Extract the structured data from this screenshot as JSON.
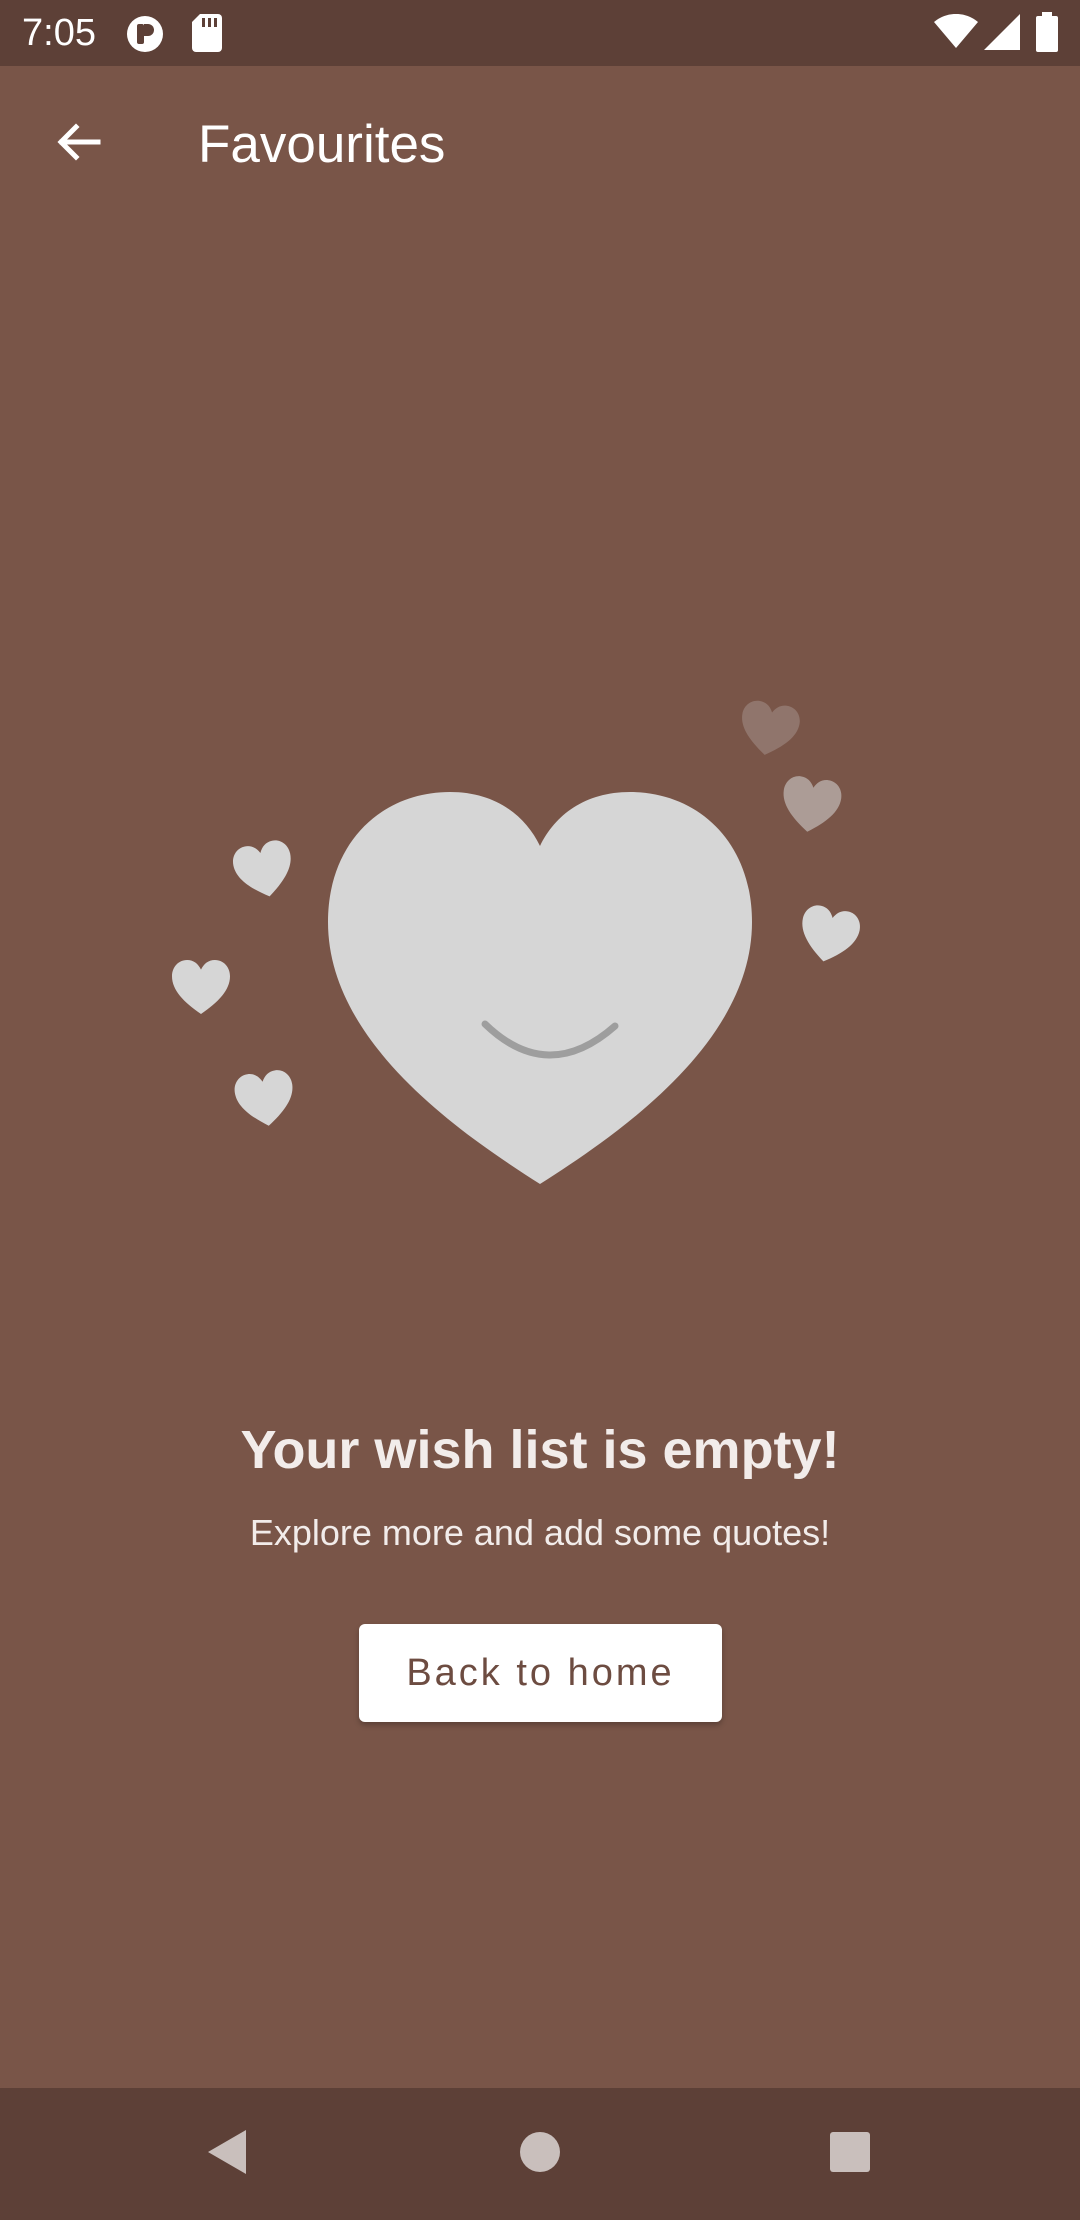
{
  "status_bar": {
    "time": "7:05",
    "left_icons": [
      "notification-app-icon",
      "sd-card-icon"
    ],
    "right_icons": [
      "wifi-icon",
      "signal-icon",
      "battery-icon"
    ]
  },
  "app_bar": {
    "title": "Favourites",
    "back_icon": "arrow-back-icon"
  },
  "empty_state": {
    "illustration": "smiling-heart-icon",
    "title": "Your wish list is empty!",
    "subtitle": "Explore more and add some quotes!",
    "button_label": "Back to home"
  },
  "nav_bar": {
    "items": [
      "back-triangle-icon",
      "home-circle-icon",
      "recents-square-icon"
    ]
  },
  "colors": {
    "background": "#795548",
    "status_nav_bar": "#5d4037",
    "illustration": "#d6d6d6",
    "button_text": "#6d4c41"
  }
}
